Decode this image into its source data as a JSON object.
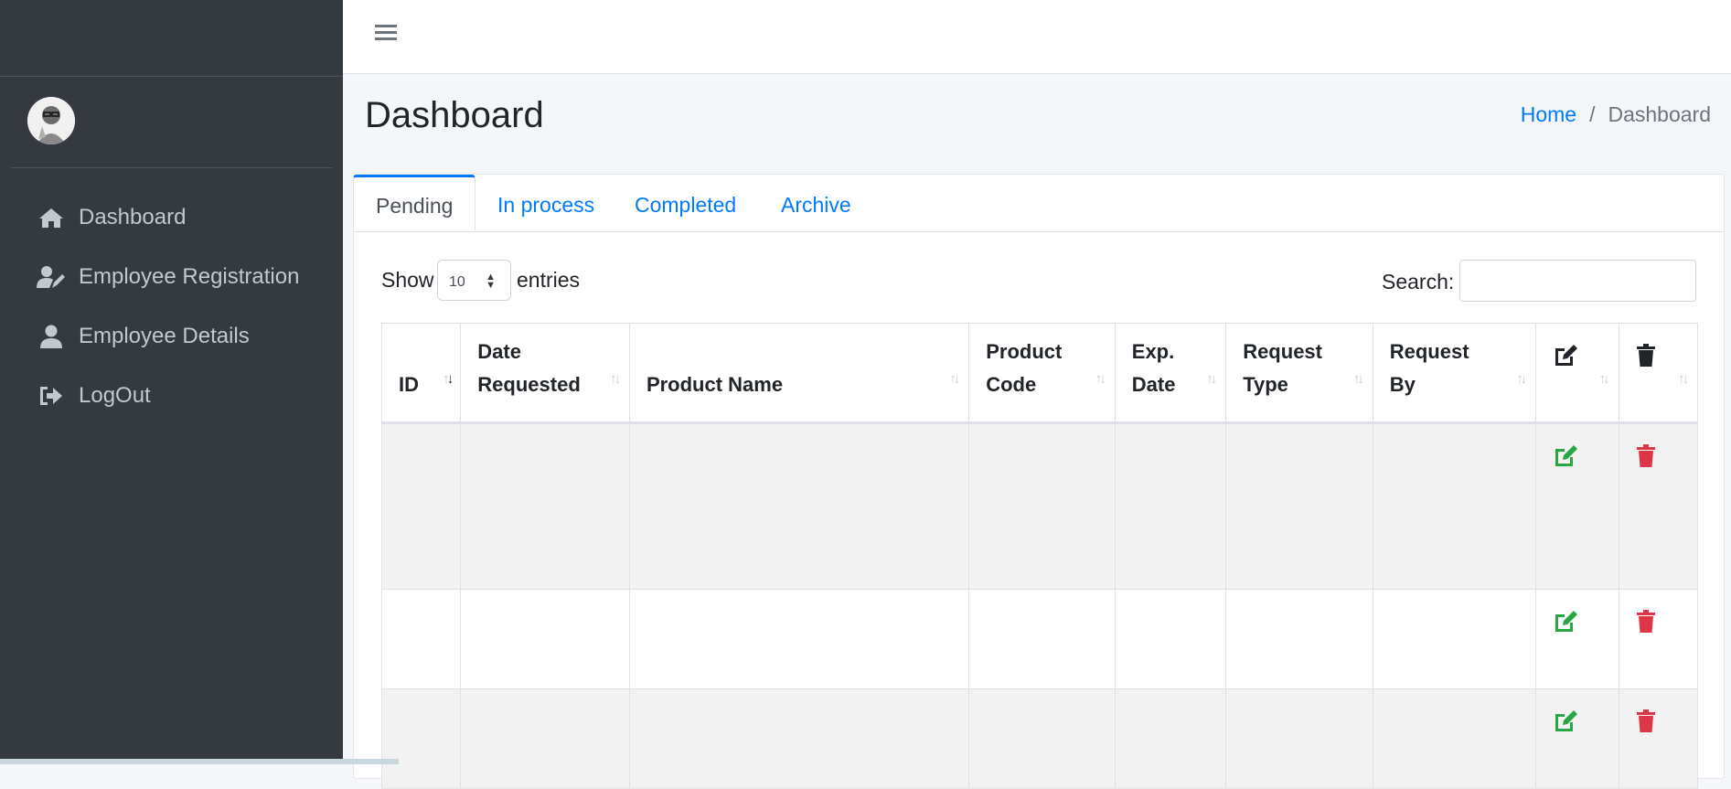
{
  "sidebar": {
    "items": [
      {
        "label": "Dashboard",
        "icon": "home-icon"
      },
      {
        "label": "Employee Registration",
        "icon": "user-edit-icon"
      },
      {
        "label": "Employee Details",
        "icon": "user-icon"
      },
      {
        "label": "LogOut",
        "icon": "sign-out-icon"
      }
    ]
  },
  "header": {
    "menu_icon": "hamburger-icon"
  },
  "page": {
    "title": "Dashboard"
  },
  "breadcrumb": {
    "home": "Home",
    "separator": "/",
    "current": "Dashboard"
  },
  "tabs": [
    {
      "label": "Pending",
      "active": true
    },
    {
      "label": "In process",
      "active": false
    },
    {
      "label": "Completed",
      "active": false
    },
    {
      "label": "Archive",
      "active": false
    }
  ],
  "table_controls": {
    "show_label": "Show",
    "entries_value": "10",
    "entries_label": "entries",
    "search_label": "Search:",
    "search_value": ""
  },
  "table": {
    "columns": [
      {
        "lines": [
          "ID"
        ]
      },
      {
        "lines": [
          "Date",
          "Requested"
        ]
      },
      {
        "lines": [
          "Product Name"
        ]
      },
      {
        "lines": [
          "Product",
          "Code"
        ]
      },
      {
        "lines": [
          "Exp.",
          "Date"
        ]
      },
      {
        "lines": [
          "Request",
          "Type"
        ]
      },
      {
        "lines": [
          "Request",
          "By"
        ]
      },
      {
        "icon": "edit-icon"
      },
      {
        "icon": "trash-icon"
      }
    ],
    "rows": [
      {
        "id": "",
        "date_requested": "",
        "product_name": "",
        "product_code": "",
        "exp_date": "",
        "request_type": "",
        "request_by": ""
      },
      {
        "id": "",
        "date_requested": "",
        "product_name": "",
        "product_code": "",
        "exp_date": "",
        "request_type": "",
        "request_by": ""
      },
      {
        "id": "",
        "date_requested": "",
        "product_name": "",
        "product_code": "",
        "exp_date": "",
        "request_type": "",
        "request_by": ""
      }
    ]
  },
  "colors": {
    "sidebar_bg": "#343a40",
    "accent": "#007bff",
    "edit": "#28a745",
    "delete": "#dc3545"
  }
}
